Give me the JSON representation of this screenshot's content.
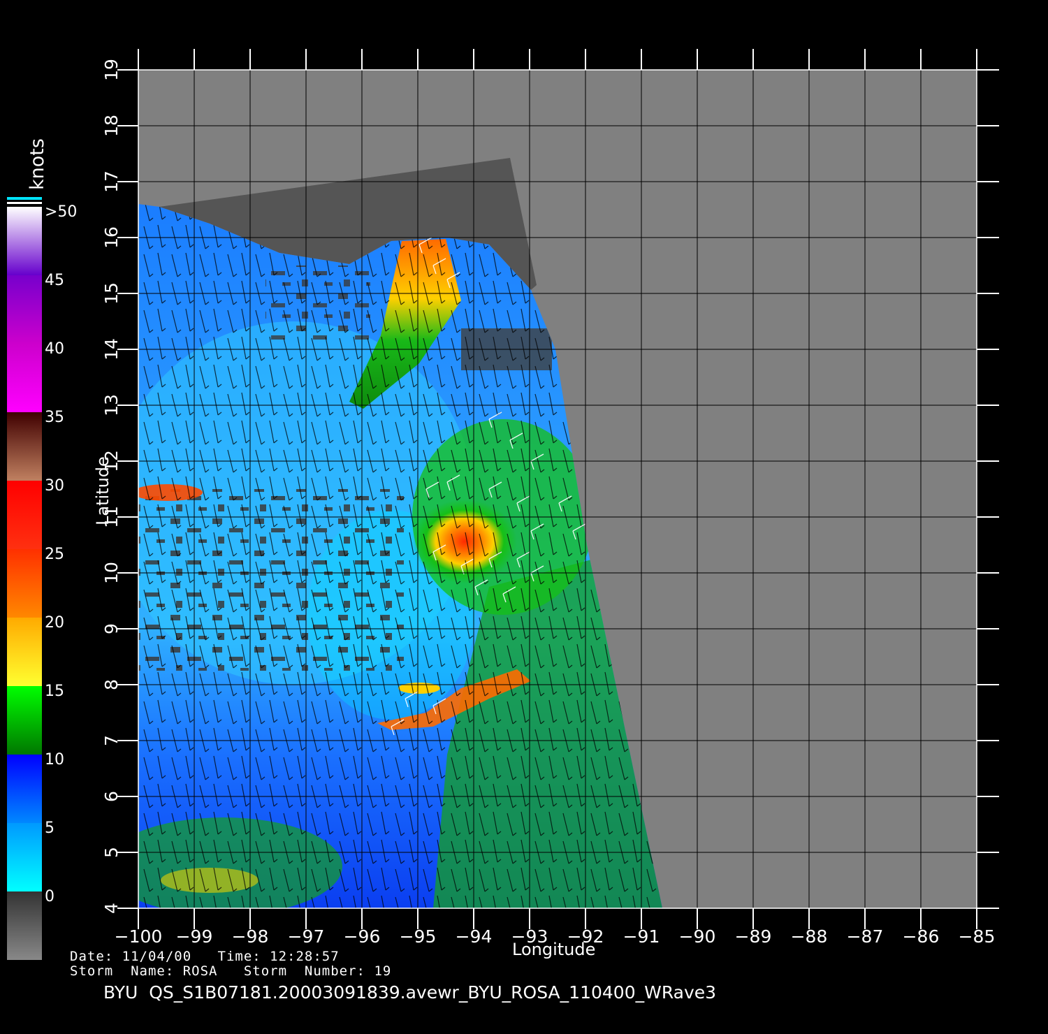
{
  "map": {
    "x_axis_label": "Longitude",
    "y_axis_label": "Latitude",
    "x_ticks": [
      "−100",
      "−99",
      "−98",
      "−97",
      "−96",
      "−95",
      "−94",
      "−93",
      "−92",
      "−91",
      "−90",
      "−89",
      "−88",
      "−87",
      "−86",
      "−85"
    ],
    "y_ticks": [
      "4",
      "5",
      "6",
      "7",
      "8",
      "9",
      "10",
      "11",
      "12",
      "13",
      "14",
      "15",
      "16",
      "17",
      "18",
      "19"
    ],
    "colors": {
      "background": "#000000",
      "land": "#808080",
      "swath_edge": "#555555",
      "grid": "#000000",
      "ocean_low": "#1f7fff",
      "ocean_calm": "#00e5ff",
      "wind_green": "#16c016",
      "wind_yellow": "#ffd000",
      "wind_orange": "#ff8000",
      "wind_red": "#ff2a00"
    },
    "features": [
      {
        "name": "tehuantepec-gap-wind"
      },
      {
        "name": "storm-rosa-core"
      },
      {
        "name": "southern-rainband"
      }
    ]
  },
  "legend": {
    "title": "knots",
    "labels": [
      ">50",
      "45",
      "40",
      "35",
      "30",
      "25",
      "20",
      "15",
      "10",
      "5",
      "0"
    ],
    "bands": [
      {
        "top": "#ffffff",
        "bottom": "#6600cc",
        "name": "over-50"
      },
      {
        "top": "#7700cc",
        "bottom": "#cc00cc",
        "name": "45-50"
      },
      {
        "top": "#cc00cc",
        "bottom": "#ff00ff",
        "name": "40-45"
      },
      {
        "top": "#400000",
        "bottom": "#c08060",
        "name": "35-40"
      },
      {
        "top": "#ff0000",
        "bottom": "#ff3010",
        "name": "30-35"
      },
      {
        "top": "#ff3000",
        "bottom": "#ff8800",
        "name": "25-30"
      },
      {
        "top": "#ffaa00",
        "bottom": "#ffff30",
        "name": "20-25"
      },
      {
        "top": "#00ff00",
        "bottom": "#007700",
        "name": "15-20"
      },
      {
        "top": "#0000ff",
        "bottom": "#0088ff",
        "name": "10-15"
      },
      {
        "top": "#0099ff",
        "bottom": "#00ffff",
        "name": "5-10"
      },
      {
        "top": "#333333",
        "bottom": "#888888",
        "name": "0-5"
      }
    ]
  },
  "meta": {
    "date_label": "Date:",
    "date": "11/04/00",
    "time_label": "Time:",
    "time": "12:28:57",
    "storm_name_label": "Storm  Name:",
    "storm_name": "ROSA",
    "storm_number_label": "Storm  Number:",
    "storm_number": "19"
  },
  "footer": {
    "filename": "BYU  QS_S1B07181.20003091839.avewr_BYU_ROSA_110400_WRave3"
  }
}
